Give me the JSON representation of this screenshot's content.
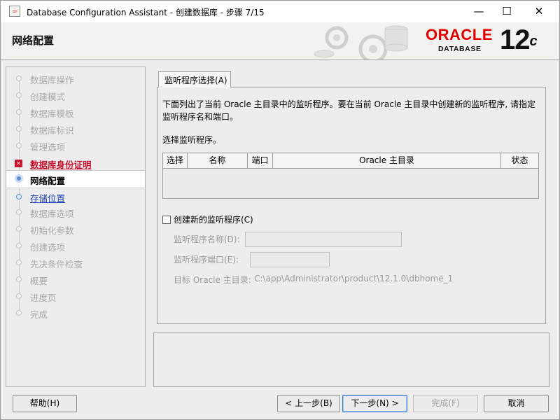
{
  "window": {
    "title": "Database Configuration Assistant - 创建数据库 - 步骤 7/15",
    "controls": {
      "minimize": "—",
      "maximize": "☐",
      "close": "✕"
    }
  },
  "header": {
    "title": "网络配置",
    "logo": {
      "brand": "ORACLE",
      "product": "DATABASE",
      "version": "12",
      "version_suffix": "c"
    }
  },
  "nav": {
    "items": [
      {
        "label": "数据库操作",
        "state": "done"
      },
      {
        "label": "创建模式",
        "state": "done"
      },
      {
        "label": "数据库模板",
        "state": "done"
      },
      {
        "label": "数据库标识",
        "state": "done"
      },
      {
        "label": "管理选项",
        "state": "done"
      },
      {
        "label": "数据库身份证明",
        "state": "error"
      },
      {
        "label": "网络配置",
        "state": "current"
      },
      {
        "label": "存储位置",
        "state": "link"
      },
      {
        "label": "数据库选项",
        "state": "pending"
      },
      {
        "label": "初始化参数",
        "state": "pending"
      },
      {
        "label": "创建选项",
        "state": "pending"
      },
      {
        "label": "先决条件检查",
        "state": "pending"
      },
      {
        "label": "概要",
        "state": "pending"
      },
      {
        "label": "进度页",
        "state": "pending"
      },
      {
        "label": "完成",
        "state": "pending"
      }
    ]
  },
  "main": {
    "tab_label": "监听程序选择(A)",
    "description": "下面列出了当前 Oracle 主目录中的监听程序。要在当前 Oracle 主目录中创建新的监听程序, 请指定监听程序名和端口。",
    "select_label": "选择监听程序。",
    "table": {
      "columns": [
        "选择",
        "名称",
        "端口",
        "Oracle 主目录",
        "状态"
      ],
      "rows": []
    },
    "create_checkbox": {
      "label": "创建新的监听程序(C)",
      "checked": false
    },
    "listener_name_label": "监听程序名称(D):",
    "listener_name_value": "",
    "listener_port_label": "监听程序端口(E):",
    "listener_port_value": "",
    "oracle_home_label": "目标 Oracle 主目录:",
    "oracle_home_value": "C:\\app\\Administrator\\product\\12.1.0\\dbhome_1"
  },
  "buttons": {
    "help": "帮助(H)",
    "back": "< 上一步(B)",
    "next": "下一步(N) >",
    "finish": "完成(F)",
    "cancel": "取消"
  },
  "colors": {
    "error": "#c8102e",
    "link": "#1a3fb0",
    "oracle_red": "#e00000"
  }
}
